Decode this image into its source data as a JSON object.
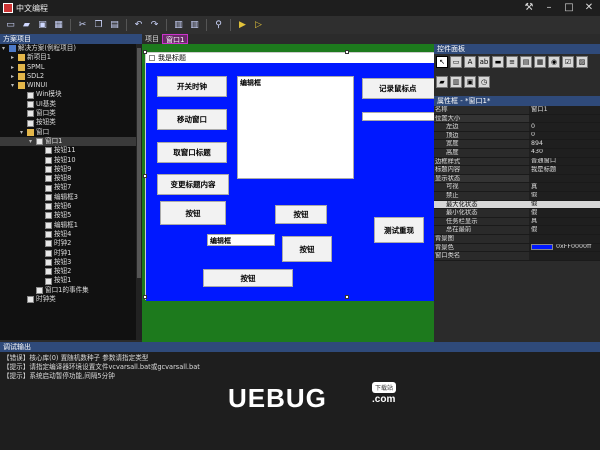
{
  "window": {
    "title": "中文编程"
  },
  "toolbar": {
    "icons": [
      "new-file-icon",
      "open-folder-icon",
      "save-icon",
      "save-all-icon",
      "cut-icon",
      "copy-icon",
      "paste-icon",
      "undo-icon",
      "redo-icon",
      "layout-icon",
      "layout2-icon",
      "find-icon",
      "run-icon",
      "step-icon"
    ]
  },
  "tree": {
    "header": "方案项目",
    "items": [
      {
        "label": "解决方案(例程项目)",
        "type": "sol",
        "indent": 0,
        "exp": "▾"
      },
      {
        "label": "新项目1",
        "type": "folder",
        "indent": 1,
        "exp": "▸"
      },
      {
        "label": "SPML",
        "type": "folder",
        "indent": 1,
        "exp": "▸"
      },
      {
        "label": "SDL2",
        "type": "folder",
        "indent": 1,
        "exp": "▸"
      },
      {
        "label": "WINUI",
        "type": "folder",
        "indent": 1,
        "exp": "▾"
      },
      {
        "label": "Win模块",
        "type": "file",
        "indent": 2,
        "exp": ""
      },
      {
        "label": "UI基类",
        "type": "file",
        "indent": 2,
        "exp": ""
      },
      {
        "label": "窗口类",
        "type": "file",
        "indent": 2,
        "exp": ""
      },
      {
        "label": "按钮类",
        "type": "file",
        "indent": 2,
        "exp": ""
      },
      {
        "label": "窗口",
        "type": "folder",
        "indent": 2,
        "exp": "▾"
      },
      {
        "label": "窗口1",
        "type": "file",
        "indent": 3,
        "exp": "▾",
        "sel": true
      },
      {
        "label": "按钮11",
        "type": "file",
        "indent": 4,
        "exp": ""
      },
      {
        "label": "按钮10",
        "type": "file",
        "indent": 4,
        "exp": ""
      },
      {
        "label": "按钮9",
        "type": "file",
        "indent": 4,
        "exp": ""
      },
      {
        "label": "按钮8",
        "type": "file",
        "indent": 4,
        "exp": ""
      },
      {
        "label": "按钮7",
        "type": "file",
        "indent": 4,
        "exp": ""
      },
      {
        "label": "编辑框3",
        "type": "file",
        "indent": 4,
        "exp": ""
      },
      {
        "label": "按钮6",
        "type": "file",
        "indent": 4,
        "exp": ""
      },
      {
        "label": "按钮5",
        "type": "file",
        "indent": 4,
        "exp": ""
      },
      {
        "label": "编辑框1",
        "type": "file",
        "indent": 4,
        "exp": ""
      },
      {
        "label": "按钮4",
        "type": "file",
        "indent": 4,
        "exp": ""
      },
      {
        "label": "时钟2",
        "type": "file",
        "indent": 4,
        "exp": ""
      },
      {
        "label": "时钟1",
        "type": "file",
        "indent": 4,
        "exp": ""
      },
      {
        "label": "按钮3",
        "type": "file",
        "indent": 4,
        "exp": ""
      },
      {
        "label": "按钮2",
        "type": "file",
        "indent": 4,
        "exp": ""
      },
      {
        "label": "按钮1",
        "type": "file",
        "indent": 4,
        "exp": ""
      },
      {
        "label": "窗口1的事件集",
        "type": "file",
        "indent": 3,
        "exp": ""
      },
      {
        "label": "时钟类",
        "type": "file",
        "indent": 2,
        "exp": ""
      }
    ]
  },
  "tabs": [
    {
      "label": "项目",
      "active": false
    },
    {
      "label": "窗口1",
      "active": true
    }
  ],
  "form": {
    "title": "我是标题",
    "buttons": [
      {
        "label": "开关时钟"
      },
      {
        "label": "移动窗口"
      },
      {
        "label": "取窗口标题"
      },
      {
        "label": "变更标题内容"
      },
      {
        "label": "按钮"
      },
      {
        "label": "记录鼠标点"
      },
      {
        "label": "按钮"
      },
      {
        "label": "测试重现"
      },
      {
        "label": "按钮"
      },
      {
        "label": "按钮"
      }
    ],
    "edits": [
      {
        "label": "编辑框"
      },
      {
        "label": "编辑框"
      }
    ]
  },
  "props": {
    "palette_header": "控件面板",
    "header": "属性框 - *窗口1*",
    "rows": [
      {
        "k": "名称",
        "v": "窗口1",
        "in": false
      },
      {
        "k": "位置大小",
        "v": "",
        "in": false,
        "sec": true
      },
      {
        "k": "左边",
        "v": "0",
        "in": true
      },
      {
        "k": "顶边",
        "v": "0",
        "in": true
      },
      {
        "k": "宽度",
        "v": "894",
        "in": true
      },
      {
        "k": "高度",
        "v": "430",
        "in": true
      },
      {
        "k": "边框样式",
        "v": "普通窗口",
        "in": false
      },
      {
        "k": "标题内容",
        "v": "我是标题",
        "in": false
      },
      {
        "k": "显示状态",
        "v": "",
        "in": false,
        "sec": true
      },
      {
        "k": "可视",
        "v": "真",
        "in": true
      },
      {
        "k": "禁止",
        "v": "假",
        "in": true
      },
      {
        "k": "最大化状态",
        "v": "假",
        "in": true,
        "hl": true
      },
      {
        "k": "最小化状态",
        "v": "假",
        "in": true
      },
      {
        "k": "任务栏显示",
        "v": "真",
        "in": true
      },
      {
        "k": "总在最前",
        "v": "假",
        "in": true
      },
      {
        "k": "背景图",
        "v": "",
        "in": false
      },
      {
        "k": "背景色",
        "v": "0xFF0000ff",
        "in": false,
        "swatch": true
      },
      {
        "k": "窗口类名",
        "v": "",
        "in": false
      }
    ]
  },
  "output": {
    "header": "调试输出",
    "lines": [
      "【错误】核心库(0) 置随机数种子 参数请指定类型",
      "【提示】请指定编译器环境设置文件vcvarsall.bat或gcvarsall.bat",
      "【提示】系统启动暂停功能,间隔5分钟"
    ]
  },
  "watermark": {
    "logo": "UEBUG",
    "download": "下载站",
    "domain": ".com"
  },
  "colors": {
    "form_bg": "#0018ff",
    "canvas_bg": "#1d7a1d",
    "panel_header": "#2f4a7a"
  }
}
